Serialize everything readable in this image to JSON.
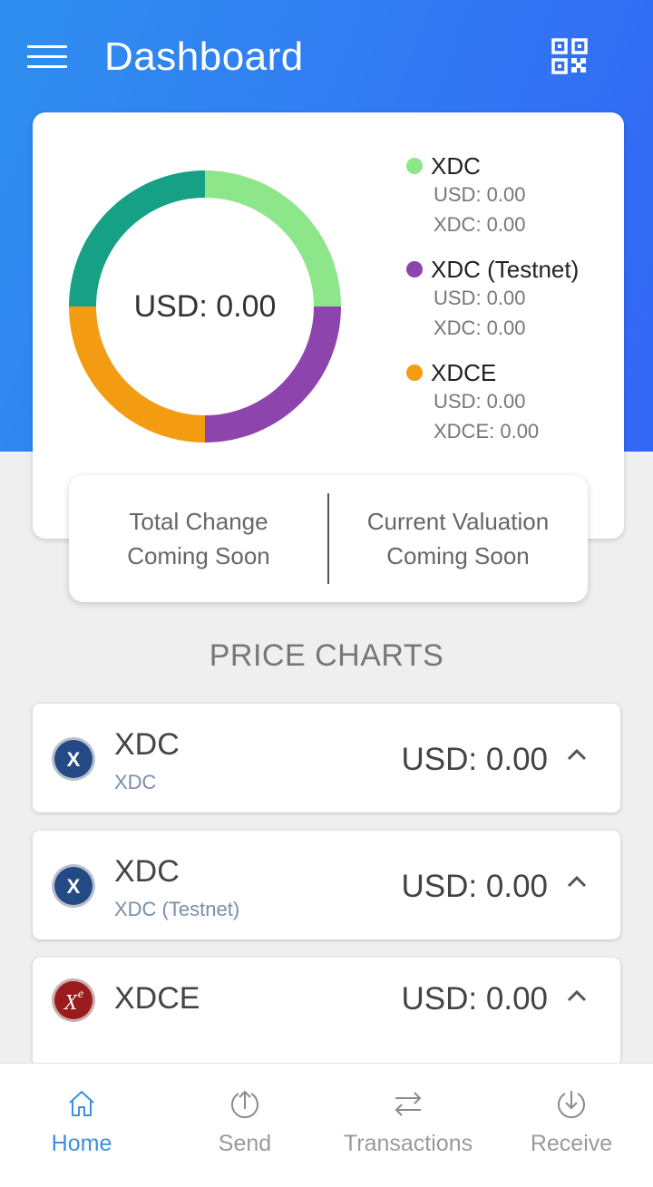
{
  "header": {
    "title": "Dashboard"
  },
  "colors": {
    "header_start": "#2f8fef",
    "header_end": "#3366f5",
    "xdc": "#8ee68a",
    "xdc_testnet": "#8e44ad",
    "xdce": "#f39c12",
    "extra": "#16a085",
    "nav_active": "#3d8fe0"
  },
  "summary": {
    "total": "USD: 0.00",
    "legend": [
      {
        "name": "XDC",
        "color": "#8ee68a",
        "usd": "USD: 0.00",
        "amount": "XDC: 0.00"
      },
      {
        "name": "XDC (Testnet)",
        "color": "#8e44ad",
        "usd": "USD: 0.00",
        "amount": "XDC: 0.00"
      },
      {
        "name": "XDCE",
        "color": "#f39c12",
        "usd": "USD: 0.00",
        "amount": "XDCE: 0.00"
      }
    ]
  },
  "stats": {
    "total_change_label": "Total Change",
    "total_change_value": "Coming Soon",
    "current_valuation_label": "Current Valuation",
    "current_valuation_value": "Coming Soon"
  },
  "price_charts": {
    "title": "PRICE CHARTS",
    "items": [
      {
        "name": "XDC",
        "network": "XDC",
        "price": "USD: 0.00",
        "icon": "xdc-coin-icon",
        "icon_letter": "X"
      },
      {
        "name": "XDC",
        "network": "XDC (Testnet)",
        "price": "USD: 0.00",
        "icon": "xdc-coin-icon",
        "icon_letter": "X"
      },
      {
        "name": "XDCE",
        "network": "",
        "price": "USD: 0.00",
        "icon": "xdce-coin-icon",
        "icon_letter": "X",
        "icon_superscript": "e"
      }
    ]
  },
  "nav": {
    "items": [
      {
        "label": "Home",
        "icon": "home-icon",
        "active": true
      },
      {
        "label": "Send",
        "icon": "upload-icon",
        "active": false
      },
      {
        "label": "Transactions",
        "icon": "swap-icon",
        "active": false
      },
      {
        "label": "Receive",
        "icon": "download-icon",
        "active": false
      }
    ]
  }
}
